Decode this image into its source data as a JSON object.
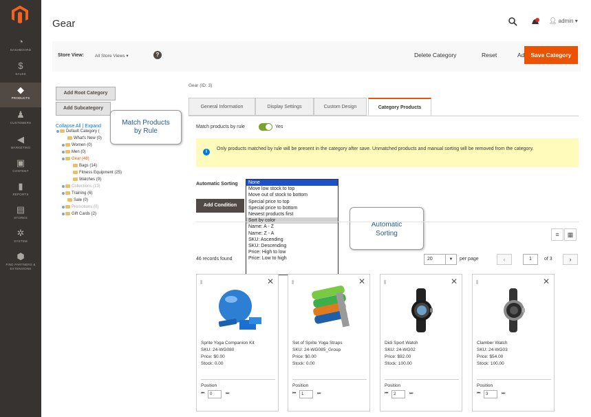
{
  "sidebar": {
    "items": [
      {
        "label": "DASHBOARD",
        "icon": "dashboard-icon"
      },
      {
        "label": "SALES",
        "icon": "dollar-icon"
      },
      {
        "label": "PRODUCTS",
        "icon": "cube-icon"
      },
      {
        "label": "CUSTOMERS",
        "icon": "person-icon"
      },
      {
        "label": "MARKETING",
        "icon": "megaphone-icon"
      },
      {
        "label": "CONTENT",
        "icon": "layout-icon"
      },
      {
        "label": "REPORTS",
        "icon": "bar-chart-icon"
      },
      {
        "label": "STORES",
        "icon": "store-icon"
      },
      {
        "label": "SYSTEM",
        "icon": "gear-icon"
      },
      {
        "label": "FIND PARTNERS & EXTENSIONS",
        "icon": "puzzle-icon"
      }
    ],
    "active_index": 2
  },
  "header": {
    "title": "Gear",
    "user": "admin"
  },
  "action_bar": {
    "store_view_label": "Store View:",
    "store_view_value": "All Store Views",
    "help": "?",
    "delete": "Delete Category",
    "reset": "Reset",
    "add_event": "Add Event...",
    "save": "Save Category"
  },
  "left": {
    "add_root": "Add Root Category",
    "add_sub": "Add Subcategory",
    "collapse": "Collapse All | Expand",
    "tree": [
      "Default Category (",
      "What's New (0)",
      "Women (0)",
      "Men (0)",
      "Gear (48)",
      "Bags (14)",
      "Fitness Equipment (25)",
      "Watches (9)",
      "Collections (13)",
      "Training (6)",
      "Sale (0)",
      "Promotions (0)",
      "Gift Cards (2)"
    ]
  },
  "callouts": {
    "match": "Match Products by Rule",
    "sort": "Automatic Sorting"
  },
  "gear_id": "Gear (ID: 3)",
  "tabs": [
    "General Information",
    "Display Settings",
    "Custom Design",
    "Category Products"
  ],
  "match_label": "Match products by rule",
  "match_state": "Yes",
  "notice": "Only products matched by rule will be present in the category after save. Unmatched products and manual sorting will be removed from the category.",
  "auto_sort_label": "Automatic Sorting",
  "sort_options": [
    "None",
    "Move low stock to top",
    "Move out of stock to bottom",
    "Special price to top",
    "Special price to bottom",
    "Newest products first",
    "Sort by color",
    "Name: A - Z",
    "Name: Z - A",
    "SKU: Ascending",
    "SKU: Descending",
    "Price: High to low",
    "Price: Low to high"
  ],
  "add_condition": "Add Condition",
  "records": "46 records found",
  "per_page_value": "20",
  "per_page_label": "per page",
  "page_current": "1",
  "page_total": "of 3",
  "products": [
    {
      "name": "Sprite Yoga Companion Kit",
      "sku": "SKU: 24-WG080",
      "price": "Price: $0.00",
      "stock": "Stock: 0.00",
      "position": "0",
      "image": "yoga-kit-image"
    },
    {
      "name": "Set of Sprite Yoga Straps",
      "sku": "SKU: 24-WG085_Group",
      "price": "Price: $0.00",
      "stock": "Stock: 0.00",
      "position": "1",
      "image": "yoga-straps-image"
    },
    {
      "name": "Didi Sport Watch",
      "sku": "SKU: 24-WG02",
      "price": "Price: $92.00",
      "stock": "Stock: 100.00",
      "position": "2",
      "image": "sport-watch-image"
    },
    {
      "name": "Clamber Watch",
      "sku": "SKU: 24-WG03",
      "price": "Price: $54.00",
      "stock": "Stock: 100.00",
      "position": "3",
      "image": "clamber-watch-image"
    }
  ],
  "position_label": "Position",
  "colors": {
    "accent": "#eb5202",
    "sidebar": "#373330",
    "toggle_on": "#79a22e",
    "notice_bg": "#fffbbb",
    "select_highlight": "#1e50c8"
  }
}
